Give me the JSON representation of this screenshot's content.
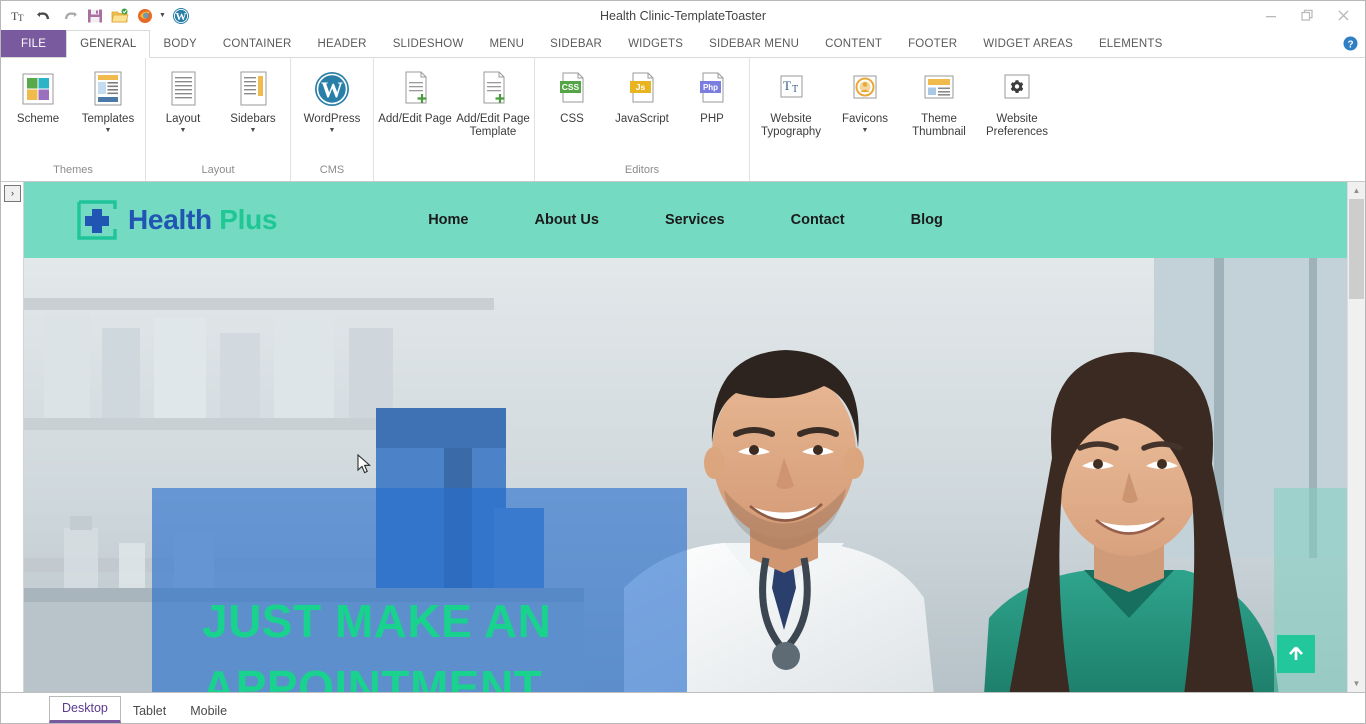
{
  "window": {
    "title": "Health Clinic-TemplateToaster",
    "controls": [
      {
        "name": "minimize",
        "glyph": "minimize-icon"
      },
      {
        "name": "restore",
        "glyph": "restore-icon"
      },
      {
        "name": "close",
        "glyph": "close-icon"
      }
    ]
  },
  "quick_access": [
    {
      "name": "text-tool-icon",
      "label": "Tt"
    },
    {
      "name": "undo-icon",
      "label": "Undo"
    },
    {
      "name": "redo-icon",
      "label": "Redo"
    },
    {
      "name": "save-icon",
      "label": "Save"
    },
    {
      "name": "open-folder-icon",
      "label": "Open"
    },
    {
      "name": "firefox-preview-icon",
      "label": "Preview in Browser"
    },
    {
      "name": "wordpress-icon",
      "label": "WordPress"
    }
  ],
  "ribbon": {
    "tabs": [
      {
        "label": "FILE",
        "kind": "file",
        "active": false
      },
      {
        "label": "GENERAL",
        "kind": "normal",
        "active": true
      },
      {
        "label": "BODY",
        "kind": "normal",
        "active": false
      },
      {
        "label": "CONTAINER",
        "kind": "normal",
        "active": false
      },
      {
        "label": "HEADER",
        "kind": "normal",
        "active": false
      },
      {
        "label": "SLIDESHOW",
        "kind": "normal",
        "active": false
      },
      {
        "label": "MENU",
        "kind": "normal",
        "active": false
      },
      {
        "label": "SIDEBAR",
        "kind": "normal",
        "active": false
      },
      {
        "label": "WIDGETS",
        "kind": "normal",
        "active": false
      },
      {
        "label": "SIDEBAR MENU",
        "kind": "normal",
        "active": false
      },
      {
        "label": "CONTENT",
        "kind": "normal",
        "active": false
      },
      {
        "label": "FOOTER",
        "kind": "normal",
        "active": false
      },
      {
        "label": "WIDGET AREAS",
        "kind": "normal",
        "active": false
      },
      {
        "label": "ELEMENTS",
        "kind": "normal",
        "active": false
      }
    ],
    "help_icon": "help-icon",
    "groups": [
      {
        "name": "themes",
        "label": "Themes",
        "items": [
          {
            "label": "Scheme",
            "icon": "color-scheme-icon",
            "dropdown": false
          },
          {
            "label": "Templates",
            "icon": "templates-icon",
            "dropdown": true
          }
        ]
      },
      {
        "name": "layout",
        "label": "Layout",
        "items": [
          {
            "label": "Layout",
            "icon": "layout-icon",
            "dropdown": true
          },
          {
            "label": "Sidebars",
            "icon": "sidebars-icon",
            "dropdown": true
          }
        ]
      },
      {
        "name": "cms",
        "label": "CMS",
        "items": [
          {
            "label": "WordPress",
            "icon": "wordpress-icon",
            "dropdown": true
          }
        ]
      },
      {
        "name": "pages",
        "label": "",
        "items": [
          {
            "label": "Add/Edit Page",
            "icon": "add-edit-page-icon",
            "dropdown": false
          },
          {
            "label": "Add/Edit Page Template",
            "icon": "add-edit-page-template-icon",
            "dropdown": false
          }
        ]
      },
      {
        "name": "editors",
        "label": "Editors",
        "items": [
          {
            "label": "CSS",
            "icon": "css-file-icon",
            "dropdown": false
          },
          {
            "label": "JavaScript",
            "icon": "js-file-icon",
            "dropdown": false
          },
          {
            "label": "PHP",
            "icon": "php-file-icon",
            "dropdown": false
          }
        ]
      },
      {
        "name": "site-settings",
        "label": "",
        "items": [
          {
            "label": "Website Typography",
            "icon": "typography-icon",
            "dropdown": false
          },
          {
            "label": "Favicons",
            "icon": "favicon-icon",
            "dropdown": true
          },
          {
            "label": "Theme Thumbnail",
            "icon": "theme-thumbnail-icon",
            "dropdown": false
          },
          {
            "label": "Website Preferences",
            "icon": "gear-icon",
            "dropdown": false
          }
        ]
      }
    ]
  },
  "canvas": {
    "expand_button": "›",
    "site": {
      "header": {
        "background": "#74dbc2",
        "logo": {
          "mark": "medical-cross-icon",
          "text_primary": "Health",
          "text_secondary": "Plus"
        },
        "nav": [
          "Home",
          "About Us",
          "Services",
          "Contact",
          "Blog"
        ]
      },
      "hero": {
        "headline": "JUST MAKE AN APPOINTMENT",
        "headline_color": "#18d28d",
        "overlay_color": "#256ecd",
        "scroll_top_icon": "arrow-up-icon",
        "scroll_top_color": "#22c89b"
      }
    }
  },
  "device_tabs": [
    {
      "label": "Desktop",
      "active": true
    },
    {
      "label": "Tablet",
      "active": false
    },
    {
      "label": "Mobile",
      "active": false
    }
  ],
  "colors": {
    "file_tab": "#7a5a9e",
    "accent_purple": "#7a5a9e",
    "site_teal": "#74dbc2",
    "logo_blue": "#2155b4",
    "logo_green": "#1fc795"
  }
}
